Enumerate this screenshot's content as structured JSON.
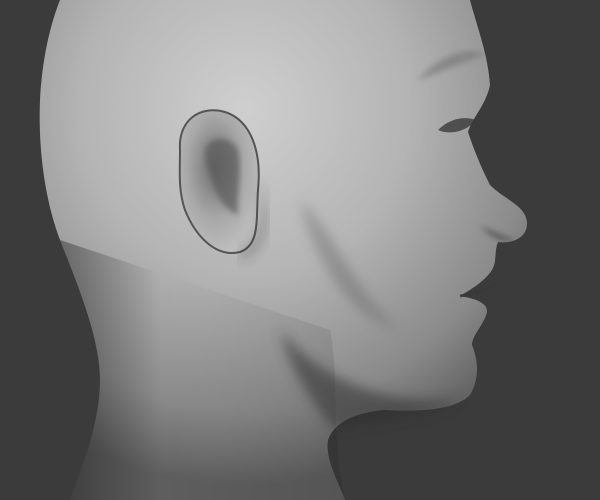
{
  "image": {
    "subject": "sculpted-head-profile",
    "colors": {
      "background": "#3b3b3b",
      "skin_light": "#c9c9c9",
      "skin_mid": "#9a9a9a",
      "skin_shadow": "#4a4a4a"
    }
  }
}
